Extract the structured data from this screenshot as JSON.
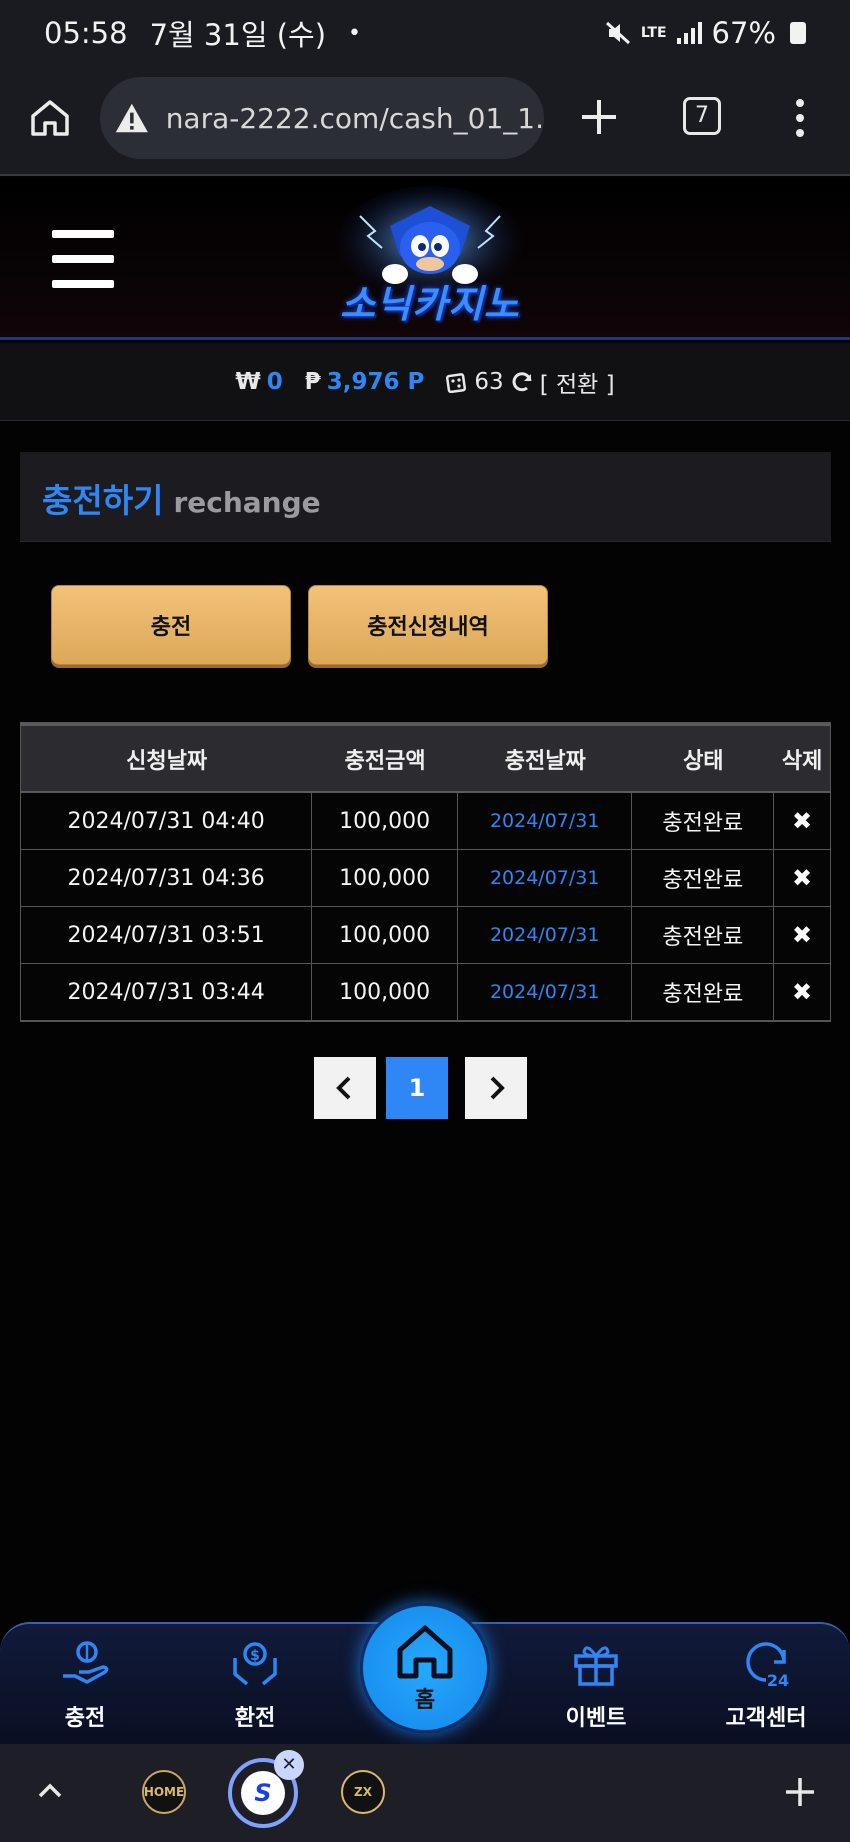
{
  "status_bar": {
    "time": "05:58",
    "date": "7월 31일 (수)",
    "dot": "•",
    "network": "LTE",
    "battery": "67%"
  },
  "browser": {
    "url": "nara-2222.com/cash_01_1.",
    "tab_count": "7"
  },
  "site": {
    "logo_text": "소닉카지노"
  },
  "balance": {
    "won_symbol": "₩",
    "won_value": "0",
    "point_symbol": "₱",
    "point_value": "3,976 P",
    "chip_value": "63",
    "convert_label": "[ 전환 ]"
  },
  "section": {
    "title_ko": "충전하기",
    "title_en": "rechange"
  },
  "buttons": {
    "charge": "충전",
    "history": "충전신청내역"
  },
  "table": {
    "headers": [
      "신청날짜",
      "충전금액",
      "충전날짜",
      "상태",
      "삭제"
    ],
    "rows": [
      {
        "requested": "2024/07/31 04:40",
        "amount": "100,000",
        "charged": "2024/07/31",
        "status": "충전완료",
        "delete": "✖"
      },
      {
        "requested": "2024/07/31 04:36",
        "amount": "100,000",
        "charged": "2024/07/31",
        "status": "충전완료",
        "delete": "✖"
      },
      {
        "requested": "2024/07/31 03:51",
        "amount": "100,000",
        "charged": "2024/07/31",
        "status": "충전완료",
        "delete": "✖"
      },
      {
        "requested": "2024/07/31 03:44",
        "amount": "100,000",
        "charged": "2024/07/31",
        "status": "충전완료",
        "delete": "✖"
      }
    ]
  },
  "pagination": {
    "prev": "‹",
    "current": "1",
    "next": "›"
  },
  "bottom_nav": {
    "charge": "충전",
    "exchange": "환전",
    "home": "홈",
    "event": "이벤트",
    "support": "고객센터"
  },
  "tab_strip": {
    "collapse": "^",
    "fav1": "HOME",
    "fav2": "S",
    "fav3": "ZX",
    "close": "✕",
    "add": "+"
  }
}
